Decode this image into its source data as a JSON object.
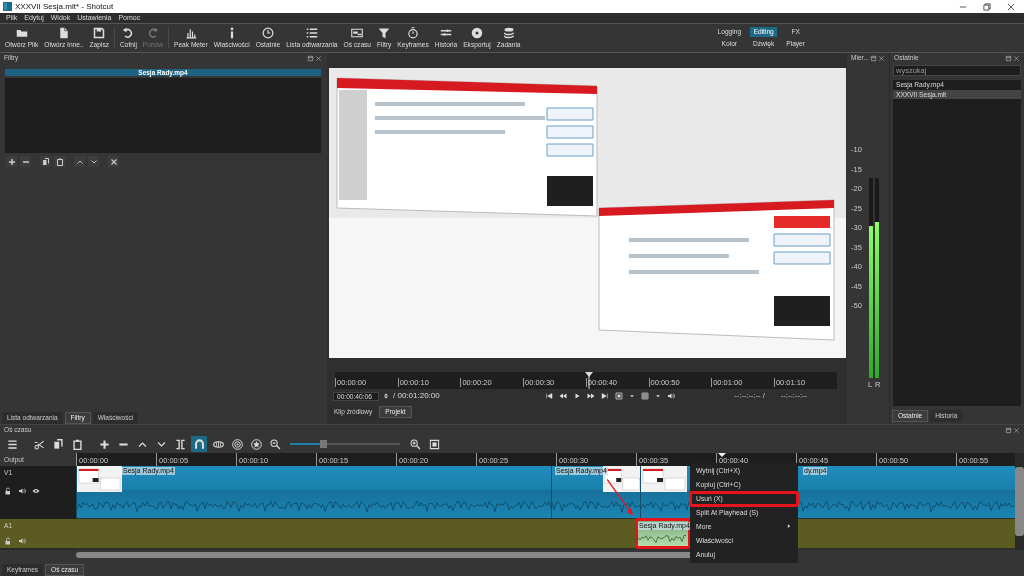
{
  "window": {
    "title": "XXXVII Sesja.mlt* - Shotcut"
  },
  "menu": [
    "Plik",
    "Edytuj",
    "Widok",
    "Ustawienia",
    "Pomoc"
  ],
  "toolbar": [
    {
      "label": "Otwórz Plik",
      "disabled": false
    },
    {
      "label": "Otwórz Inne..",
      "disabled": false
    },
    {
      "label": "Zapisz",
      "disabled": false
    },
    {
      "label": "Cofnij",
      "disabled": false
    },
    {
      "label": "Ponów",
      "disabled": true
    },
    {
      "label": "Peak Meter",
      "disabled": false
    },
    {
      "label": "Właściwości",
      "disabled": false
    },
    {
      "label": "Ostatnie",
      "disabled": false
    },
    {
      "label": "Lista odtwarzania",
      "disabled": false
    },
    {
      "label": "Oś czasu",
      "disabled": false
    },
    {
      "label": "Filtry",
      "disabled": false
    },
    {
      "label": "Keyframes",
      "disabled": false
    },
    {
      "label": "Historia",
      "disabled": false
    },
    {
      "label": "Eksportuj",
      "disabled": false
    },
    {
      "label": "Zadania",
      "disabled": false
    }
  ],
  "layouts": [
    {
      "label": "Logging",
      "selected": false
    },
    {
      "label": "Editing",
      "selected": true
    },
    {
      "label": "FX",
      "selected": false
    },
    {
      "label": "Kolor",
      "selected": false
    },
    {
      "label": "Dźwięk",
      "selected": false
    },
    {
      "label": "Player",
      "selected": false
    }
  ],
  "filters_panel": {
    "title": "Filtry",
    "clip": "Sesja Rady.mp4",
    "tabs": [
      {
        "label": "Lista odtwarzania",
        "selected": false
      },
      {
        "label": "Filtry",
        "selected": true
      },
      {
        "label": "Właściwości",
        "selected": false
      }
    ]
  },
  "player": {
    "preview": {
      "kind": "picture"
    },
    "ruler": [
      "00:00:00",
      "00:00:10",
      "00:00:20",
      "00:00:30",
      "00:00:40",
      "00:00:50",
      "00:01:00",
      "00:01:10"
    ],
    "playhead": {
      "level": 0.505
    },
    "timecode": "00:00:40:06",
    "duration": "/ 00:01:20:00",
    "in_point": "--:--:--:-- /",
    "out_point": "--:--:--:--",
    "tabs": [
      {
        "label": "Klip źródłowy",
        "selected": false
      },
      {
        "label": "Projekt",
        "selected": true
      }
    ]
  },
  "meter": {
    "title": "Mier...",
    "scale": [
      "-10",
      "-15",
      "-20",
      "-25",
      "-30",
      "-35",
      "-40",
      "-45",
      "-50"
    ],
    "channels": [
      {
        "name": "L",
        "level": 0.76
      },
      {
        "name": "R",
        "level": 0.78
      }
    ]
  },
  "recent": {
    "title": "Ostatnie",
    "search": {
      "placeholder": "wyszukaj"
    },
    "items": [
      {
        "label": "Sesja Rady.mp4",
        "selected": false
      },
      {
        "label": "XXXVII Sesja.mlt",
        "selected": true
      }
    ],
    "tabs": [
      {
        "label": "Ostatnie",
        "selected": true
      },
      {
        "label": "Historia",
        "selected": false
      }
    ]
  },
  "timeline": {
    "title": "Oś czasu",
    "snap": {
      "on": true
    },
    "zoom": {
      "level": 0.3
    },
    "output_label": "Output",
    "ruler": [
      "00:00:00",
      "00:00:05",
      "00:00:10",
      "00:00:15",
      "00:00:20",
      "00:00:25",
      "00:00:30",
      "00:00:35",
      "00:00:40",
      "00:00:45",
      "00:00:50",
      "00:00:55"
    ],
    "playhead": {
      "level": 0.688
    },
    "tracks": [
      {
        "kind": "video",
        "name": "V1",
        "clips": [
          {
            "label": "Sesja Rady.mp4",
            "highlighted": false
          },
          {
            "label": "Sesja Rady.mp4",
            "highlighted": false
          },
          {
            "label": "dy.mp4",
            "highlighted": false
          }
        ]
      },
      {
        "kind": "audio",
        "name": "A1",
        "clips": [
          {
            "label": "Sesja Rady.mp4",
            "highlighted": true
          }
        ]
      }
    ],
    "context_menu": [
      {
        "label": "Wytnij (Ctrl+X)",
        "highlighted": false,
        "submenu": false
      },
      {
        "label": "Kopiuj (Ctrl+C)",
        "highlighted": false,
        "submenu": false
      },
      {
        "label": "Usuń (X)",
        "highlighted": true,
        "submenu": false
      },
      {
        "label": "Split At Playhead (S)",
        "highlighted": false,
        "submenu": false
      },
      {
        "label": "More",
        "highlighted": false,
        "submenu": true
      },
      {
        "label": "Właściwości",
        "highlighted": false,
        "submenu": false
      },
      {
        "label": "Anuluj",
        "highlighted": false,
        "submenu": false
      }
    ],
    "tabs": [
      {
        "label": "Keyframes",
        "selected": false
      },
      {
        "label": "Oś czasu",
        "selected": true
      }
    ]
  }
}
